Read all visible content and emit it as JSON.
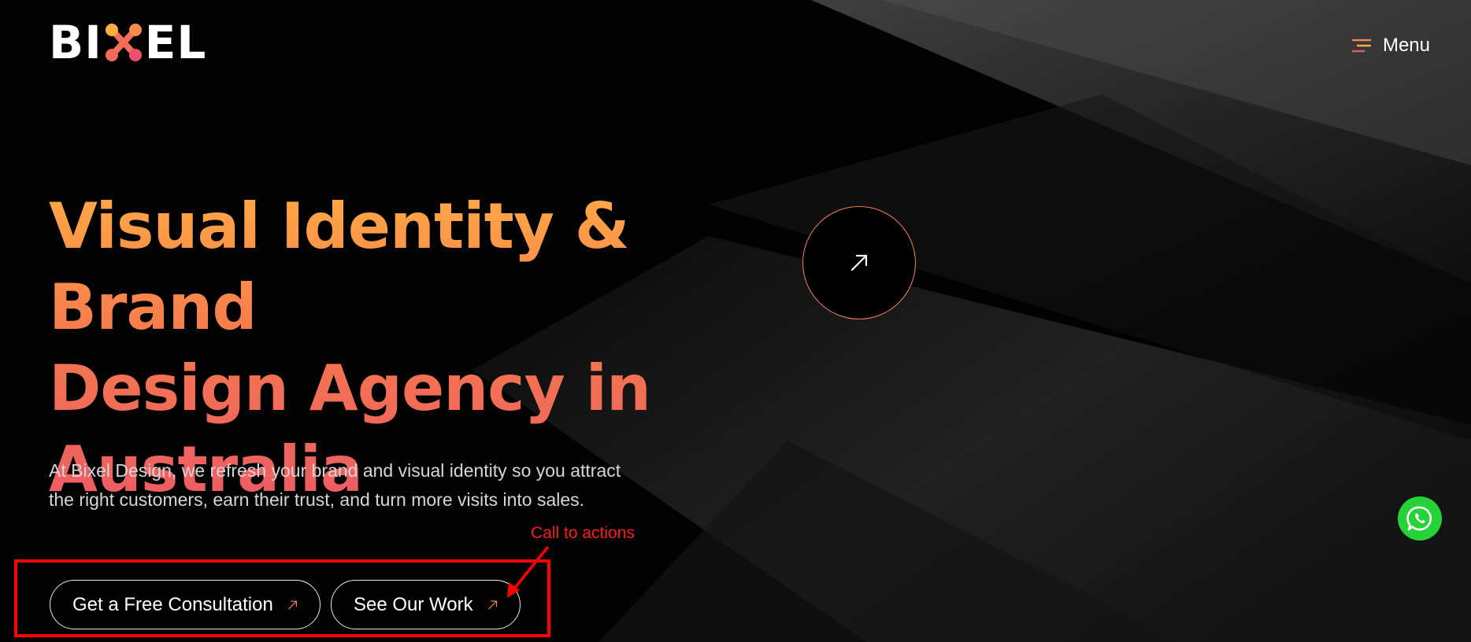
{
  "header": {
    "logo_text_left": "BI",
    "logo_text_right": "EL",
    "logo_label": "BIXEL",
    "menu_label": "Menu",
    "menu_icon": "hamburger-icon"
  },
  "hero": {
    "title_line1": "Visual Identity & Brand",
    "title_line2": "Design Agency in",
    "title_line3": "Australia",
    "description": "At Bixel Design, we refresh your brand and visual identity so you attract the right customers, earn their trust, and turn more visits into sales.",
    "circle_button_icon": "arrow-up-right-icon"
  },
  "cta": {
    "primary_label": "Get a Free Consultation",
    "secondary_label": "See Our Work",
    "icon": "arrow-up-right-icon"
  },
  "annotation": {
    "label": "Call to actions"
  },
  "floating": {
    "whatsapp_icon": "whatsapp-icon"
  },
  "colors": {
    "background": "#000000",
    "accent_orange": "#ffaa44",
    "accent_pink": "#ec5a66",
    "annotation_red": "#ff0000",
    "whatsapp_green": "#25d238"
  }
}
